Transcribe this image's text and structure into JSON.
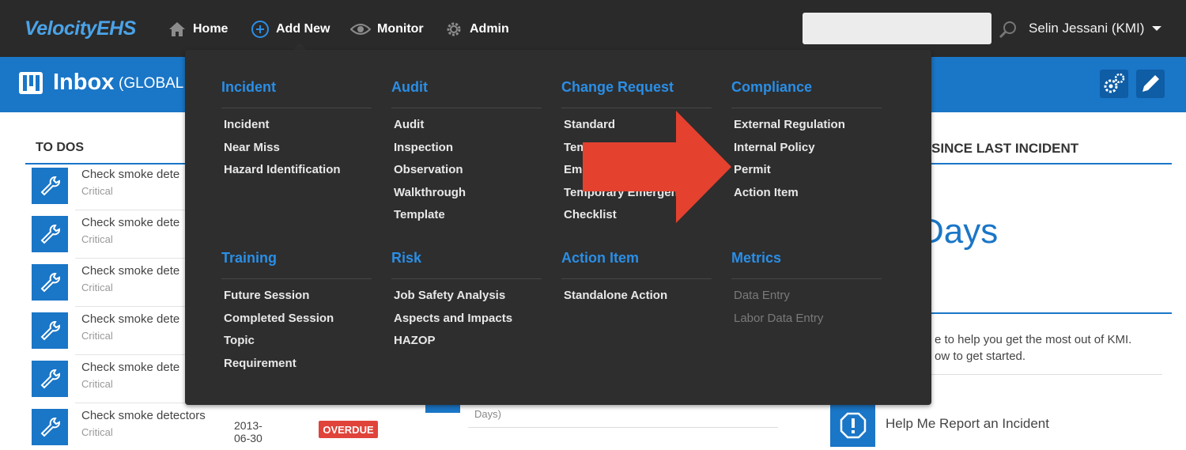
{
  "app": {
    "logo": "VelocityEHS",
    "nav": {
      "home": "Home",
      "add_new": "Add New",
      "monitor": "Monitor",
      "admin": "Admin"
    },
    "search_placeholder": "",
    "user": "Selin Jessani (KMI)"
  },
  "header": {
    "title": "Inbox",
    "subtitle": "(GLOBAL C"
  },
  "todos": {
    "heading": "TO DOS",
    "items": [
      {
        "title": "Check smoke dete",
        "priority": "Critical"
      },
      {
        "title": "Check smoke dete",
        "priority": "Critical"
      },
      {
        "title": "Check smoke dete",
        "priority": "Critical"
      },
      {
        "title": "Check smoke dete",
        "priority": "Critical"
      },
      {
        "title": "Check smoke dete",
        "priority": "Critical"
      },
      {
        "title": "Check smoke detectors",
        "priority": "Critical",
        "date": "2013-06-30",
        "status": "OVERDUE"
      }
    ],
    "days_fragment": "Days)"
  },
  "right_panel": {
    "heading": "S SINCE LAST INCIDENT",
    "days_value": "Days",
    "help_line1": "e to help you get the most out of KMI.",
    "help_line2": "ow to get started.",
    "help_link": "Help Me Report an Incident"
  },
  "menu": {
    "columns": [
      {
        "heading": "Incident",
        "items": [
          "Incident",
          "Near Miss",
          "Hazard Identification"
        ]
      },
      {
        "heading": "Audit",
        "items": [
          "Audit",
          "Inspection",
          "Observation",
          "Walkthrough",
          "Template"
        ]
      },
      {
        "heading": "Change Request",
        "items": [
          "Standard",
          "Tem",
          "Eme",
          "Temporary Emergen",
          "Checklist"
        ]
      },
      {
        "heading": "Compliance",
        "items": [
          "External Regulation",
          "Internal Policy",
          "Permit",
          "Action Item"
        ]
      },
      {
        "heading": "Training",
        "items": [
          "Future Session",
          "Completed Session",
          "Topic",
          "Requirement"
        ]
      },
      {
        "heading": "Risk",
        "items": [
          "Job Safety Analysis",
          "Aspects and Impacts",
          "HAZOP"
        ]
      },
      {
        "heading": "Action Item",
        "items": [
          "Standalone Action"
        ]
      },
      {
        "heading": "Metrics",
        "disabled_items": [
          "Data Entry",
          "Labor Data Entry"
        ]
      }
    ]
  },
  "colors": {
    "accent": "#1a76c7",
    "menu_heading": "#2a8ee6",
    "overdue": "#e0433a",
    "arrow": "#e5412f"
  }
}
